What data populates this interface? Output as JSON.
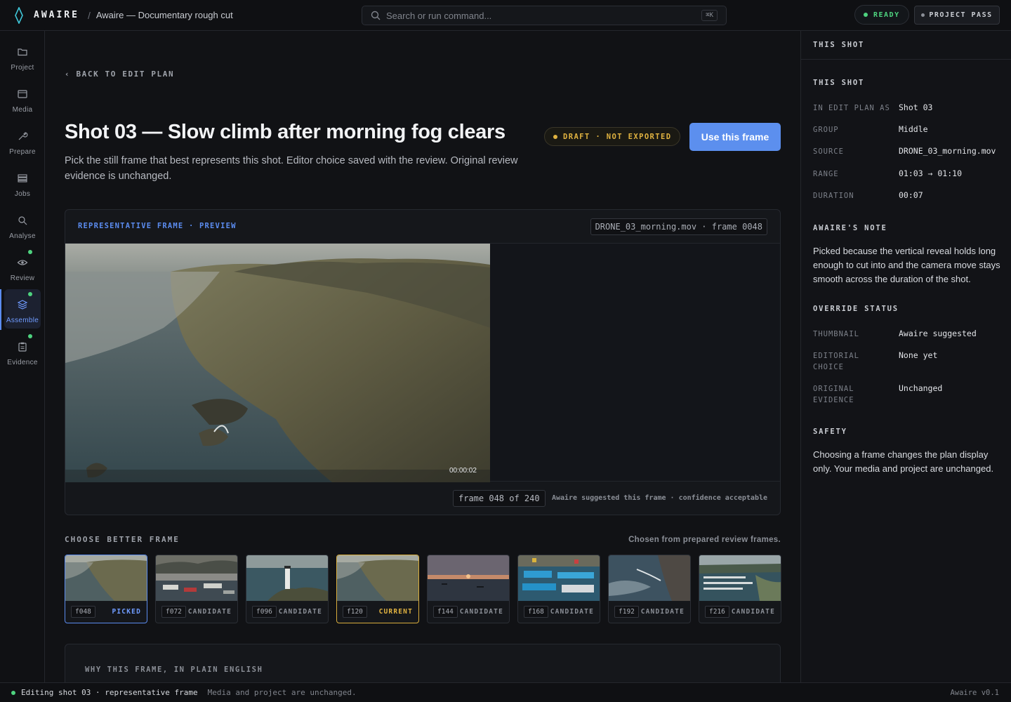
{
  "topbar": {
    "brand": "AWAIRE",
    "breadcrumb_sep": "/",
    "project_title": "Awaire — Documentary rough cut",
    "search_placeholder": "Search or run command...",
    "search_shortcut": "⌘K",
    "ready_label": "READY",
    "project_pass_label": "PROJECT PASS",
    "ready_color": "#4ed37f"
  },
  "rail": {
    "items": [
      {
        "label": "Project",
        "icon": "folder-icon"
      },
      {
        "label": "Media",
        "icon": "film-icon"
      },
      {
        "label": "Prepare",
        "icon": "wrench-icon"
      },
      {
        "label": "Jobs",
        "icon": "list-icon"
      },
      {
        "label": "Analyse",
        "icon": "magnifier-icon"
      },
      {
        "label": "Review",
        "icon": "eye-icon"
      },
      {
        "label": "Assemble",
        "icon": "layers-icon"
      },
      {
        "label": "Evidence",
        "icon": "clipboard-icon"
      }
    ],
    "active": "Assemble"
  },
  "main": {
    "back_label": "‹ BACK TO EDIT PLAN",
    "title": "Shot 03 — Slow climb after morning fog clears",
    "subtitle": "Pick the still frame that best represents this shot. Editor choice saved with the review. Original review evidence is unchanged.",
    "status_badge": "DRAFT · NOT EXPORTED",
    "use_button": "Use this frame",
    "preview": {
      "heading": "REPRESENTATIVE FRAME · PREVIEW",
      "file_chip": "DRONE_03_morning.mov · frame 0048",
      "timecode": "00:00:02",
      "frame_counter": "frame 048 of 240",
      "confidence": "Awaire suggested this frame · confidence acceptable"
    },
    "choose": {
      "heading": "CHOOSE BETTER FRAME",
      "note": "Chosen from prepared review frames.",
      "frames": [
        {
          "id": "f048",
          "status": "PICKED",
          "scene": "coast-fog"
        },
        {
          "id": "f072",
          "status": "CANDIDATE",
          "scene": "harbor-town"
        },
        {
          "id": "f096",
          "status": "CANDIDATE",
          "scene": "lighthouse"
        },
        {
          "id": "f120",
          "status": "CURRENT",
          "scene": "coast-fog"
        },
        {
          "id": "f144",
          "status": "CANDIDATE",
          "scene": "sunset-water"
        },
        {
          "id": "f168",
          "status": "CANDIDATE",
          "scene": "boats-above"
        },
        {
          "id": "f192",
          "status": "CANDIDATE",
          "scene": "cliff-waves"
        },
        {
          "id": "f216",
          "status": "CANDIDATE",
          "scene": "marina"
        }
      ]
    },
    "why_heading": "WHY THIS FRAME, IN PLAIN ENGLISH"
  },
  "side": {
    "top_title": "THIS SHOT",
    "this_shot_heading": "THIS SHOT",
    "details": [
      {
        "key": "IN EDIT PLAN AS",
        "value": "Shot 03"
      },
      {
        "key": "GROUP",
        "value": "Middle"
      },
      {
        "key": "SOURCE",
        "value": "DRONE_03_morning.mov"
      },
      {
        "key": "RANGE",
        "value": "01:03 → 01:10"
      },
      {
        "key": "DURATION",
        "value": "00:07"
      }
    ],
    "note_heading": "AWAIRE'S NOTE",
    "note_text": "Picked because the vertical reveal holds long enough to cut into and the camera move stays smooth across the duration of the shot.",
    "override_heading": "OVERRIDE STATUS",
    "override": [
      {
        "key": "THUMBNAIL",
        "value": "Awaire suggested"
      },
      {
        "key": "EDITORIAL CHOICE",
        "value": "None yet"
      },
      {
        "key": "ORIGINAL EVIDENCE",
        "value": "Unchanged"
      }
    ],
    "safety_heading": "SAFETY",
    "safety_text": "Choosing a frame changes the plan display only. Your media and project are unchanged."
  },
  "statusbar": {
    "editing": "Editing shot 03 · representative frame",
    "muted": "Media and project are unchanged.",
    "version": "Awaire v0.1"
  },
  "colors": {
    "accent": "#5c8fee",
    "draft": "#e0b240",
    "ok": "#4ed37f"
  }
}
